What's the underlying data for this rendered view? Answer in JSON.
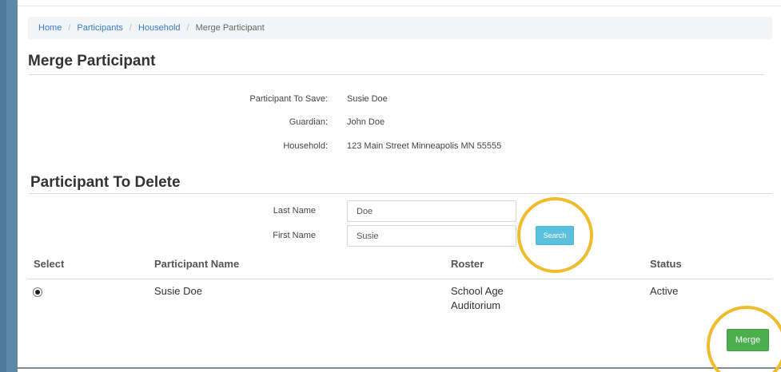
{
  "breadcrumb": {
    "items": [
      "Home",
      "Participants",
      "Household"
    ],
    "separator": "/",
    "current": "Merge Participant"
  },
  "page": {
    "title": "Merge Participant"
  },
  "save_info": {
    "participant_label": "Participant To Save:",
    "participant_value": "Susie Doe",
    "guardian_label": "Guardian:",
    "guardian_value": "John Doe",
    "household_label": "Household:",
    "household_value": "123 Main Street Minneapolis MN 55555"
  },
  "delete_section": {
    "title": "Participant To Delete",
    "last_name_label": "Last Name",
    "last_name_value": "Doe",
    "first_name_label": "First Name",
    "first_name_value": "Susie",
    "search_label": "Search"
  },
  "results_table": {
    "headers": [
      "Select",
      "Participant Name",
      "Roster",
      "Status"
    ],
    "rows": [
      {
        "selected": true,
        "name": "Susie Doe",
        "roster_line1": "School Age",
        "roster_line2": "Auditorium",
        "status": "Active"
      }
    ]
  },
  "actions": {
    "merge_label": "Merge"
  },
  "colors": {
    "accent_link": "#3a7cc4",
    "search_button": "#5bc0de",
    "merge_button": "#4cae4c",
    "highlight_ring": "#f0bc2c",
    "sidebar": "#4f7a9b"
  }
}
